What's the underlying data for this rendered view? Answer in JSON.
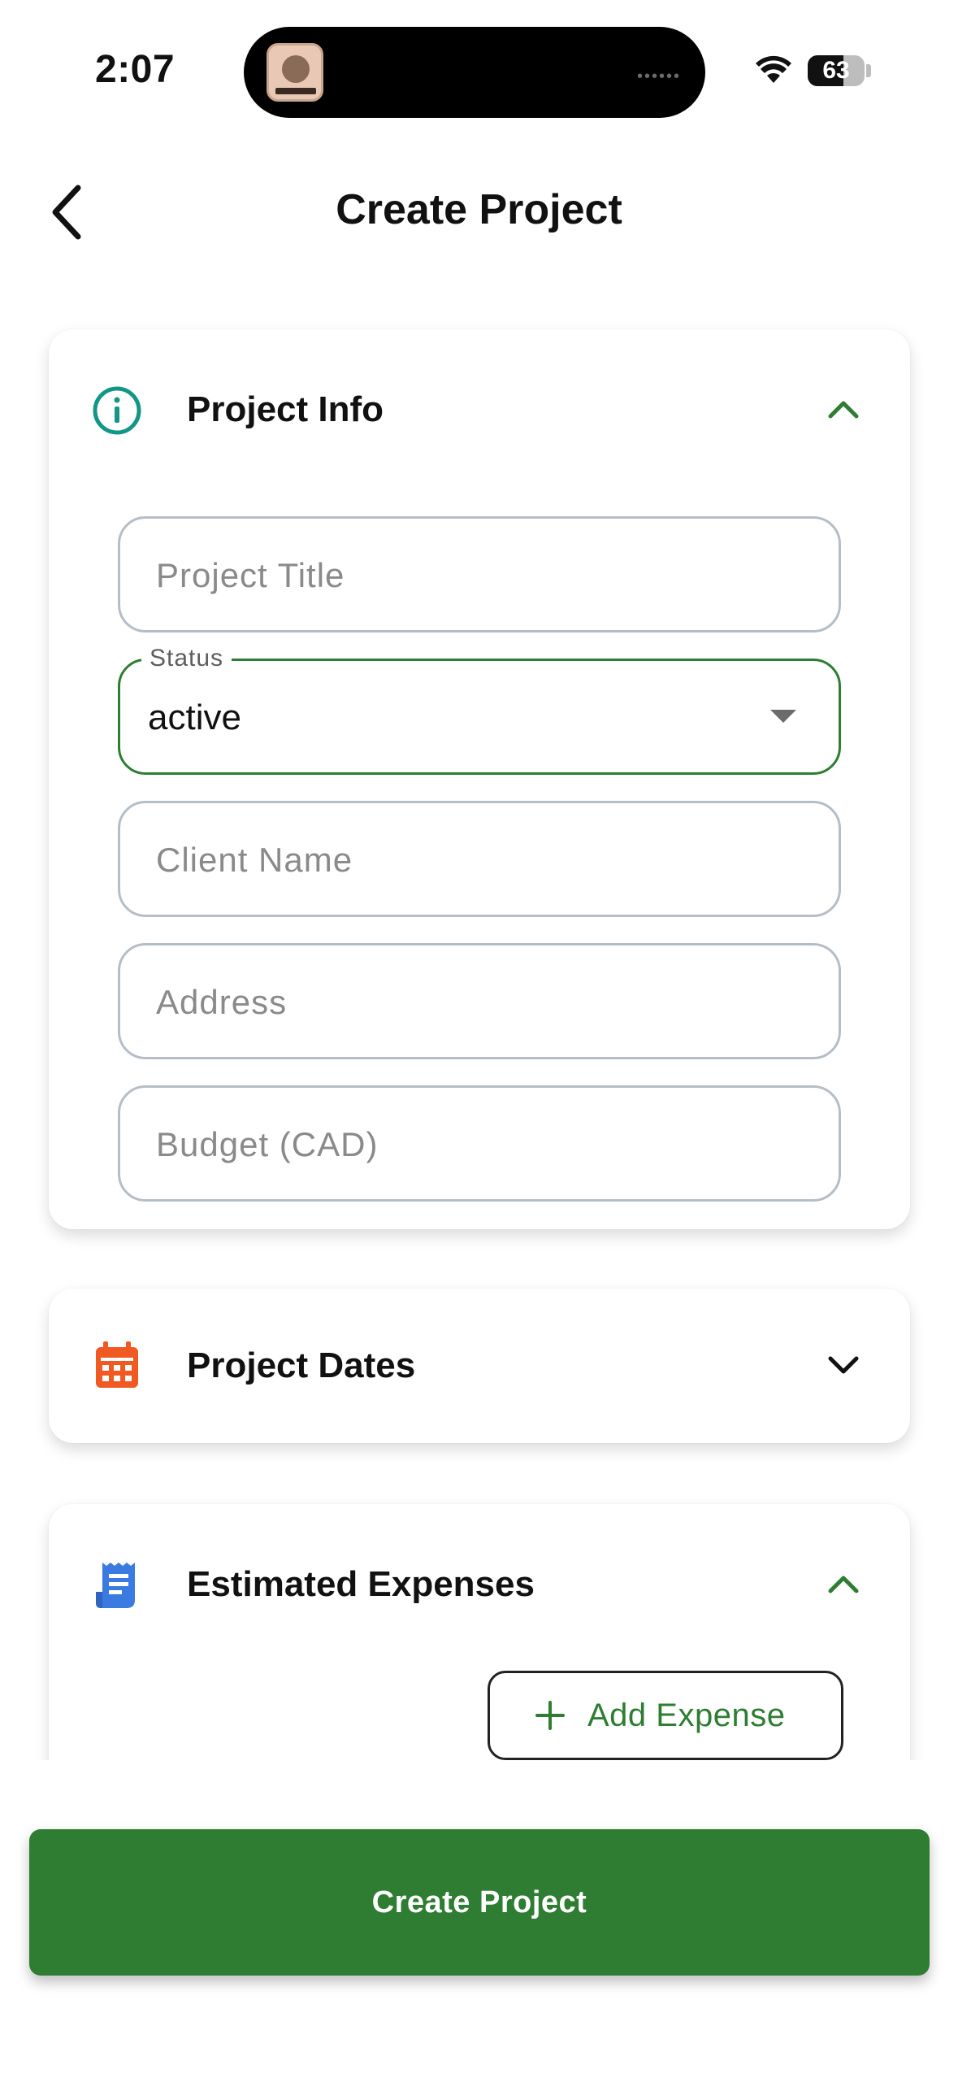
{
  "status_bar": {
    "time": "2:07",
    "battery": "63",
    "battery_level_percent": 63
  },
  "header": {
    "title": "Create Project",
    "back_icon": "chevron-left-icon"
  },
  "sections": {
    "project_info": {
      "title": "Project Info",
      "icon": "info-circle-icon",
      "icon_color": "#149687",
      "expanded": true,
      "fields": {
        "project_title": {
          "placeholder": "Project Title",
          "value": ""
        },
        "status": {
          "label": "Status",
          "value": "active"
        },
        "client_name": {
          "placeholder": "Client Name",
          "value": ""
        },
        "address": {
          "placeholder": "Address",
          "value": ""
        },
        "budget": {
          "placeholder": "Budget (CAD)",
          "value": ""
        }
      }
    },
    "project_dates": {
      "title": "Project Dates",
      "icon": "calendar-icon",
      "icon_color": "#f05a22",
      "expanded": false
    },
    "estimated_expenses": {
      "title": "Estimated Expenses",
      "icon": "receipt-icon",
      "icon_color": "#3b7ae0",
      "expanded": true,
      "add_button_label": "Add Expense"
    }
  },
  "footer": {
    "primary_button_label": "Create Project"
  },
  "colors": {
    "accent_green": "#2e7d32",
    "field_border": "#b5bec6"
  }
}
